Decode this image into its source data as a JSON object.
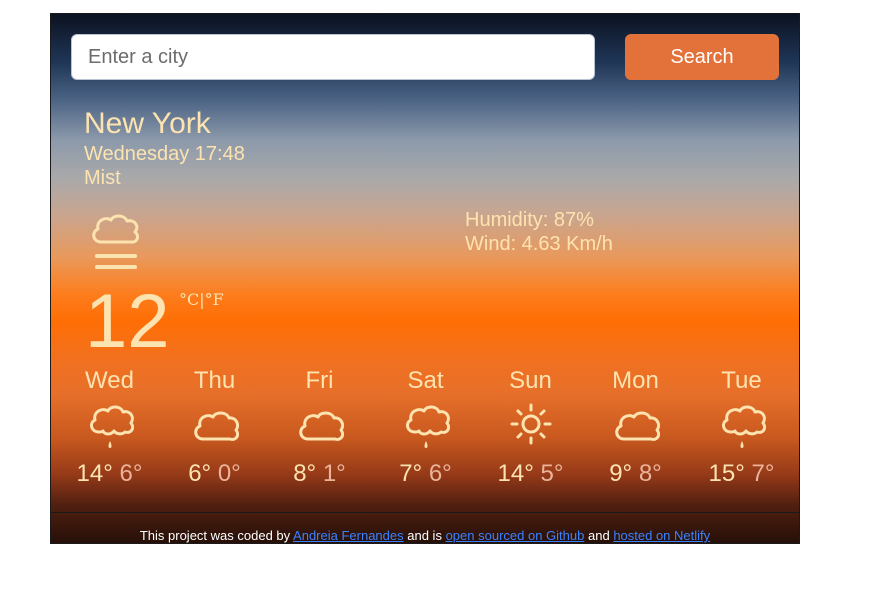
{
  "search": {
    "placeholder": "Enter a city",
    "button_label": "Search"
  },
  "current": {
    "city": "New York",
    "date": "Wednesday 17:48",
    "description": "Mist",
    "icon": "mist-icon",
    "temperature": "12",
    "unit_celsius": "°C",
    "unit_sep": "|",
    "unit_fahrenheit": "°F",
    "humidity": "Humidity: 87%",
    "wind": "Wind: 4.63 Km/h"
  },
  "forecast": [
    {
      "day": "Wed",
      "icon": "rain-icon",
      "max": "14°",
      "min": "6°"
    },
    {
      "day": "Thu",
      "icon": "cloud-icon",
      "max": "6°",
      "min": "0°"
    },
    {
      "day": "Fri",
      "icon": "cloud-icon",
      "max": "8°",
      "min": "1°"
    },
    {
      "day": "Sat",
      "icon": "rain-icon",
      "max": "7°",
      "min": "6°"
    },
    {
      "day": "Sun",
      "icon": "sun-icon",
      "max": "14°",
      "min": "5°"
    },
    {
      "day": "Mon",
      "icon": "cloud-icon",
      "max": "9°",
      "min": "8°"
    },
    {
      "day": "Tue",
      "icon": "rain-icon",
      "max": "15°",
      "min": "7°"
    }
  ],
  "footer": {
    "prefix": "This project was coded by",
    "author_link": "Andreia Fernandes",
    "middle": "and is",
    "github_link": "open sourced on Github",
    "and": "and",
    "netlify_link": "hosted on Netlify"
  },
  "colors": {
    "accent": "#e3713a",
    "text": "#fde3b0",
    "link": "#3b82ff"
  }
}
